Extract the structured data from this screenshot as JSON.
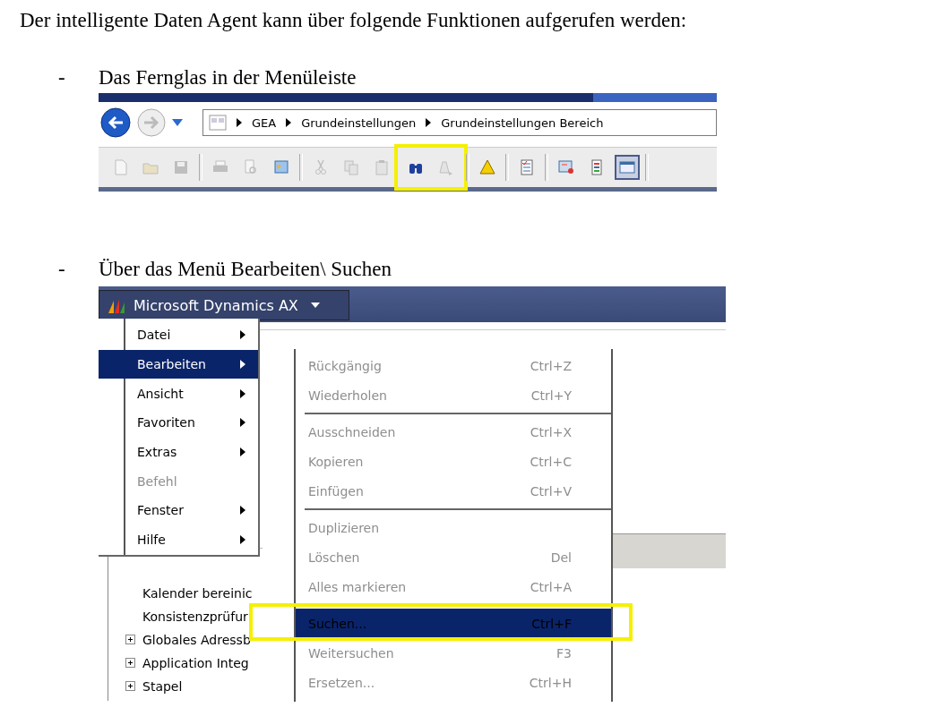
{
  "intro": "Der intelligente Daten Agent kann über folgende Funktionen aufgerufen werden:",
  "sections": [
    {
      "bullet": "-",
      "label": "Das Fernglas in der Menüleiste",
      "kind": "toolbar_shot"
    },
    {
      "bullet": "-",
      "label": "Über das Menü Bearbeiten\\ Suchen",
      "kind": "menu_shot"
    }
  ],
  "toolbar_shot": {
    "breadcrumb": [
      "GEA",
      "Grundeinstellungen",
      "Grundeinstellungen Bereich"
    ],
    "groups": [
      {
        "highlighted": false,
        "separator_after": true,
        "buttons": [
          {
            "disabled": true,
            "pressed": false
          },
          {
            "disabled": true,
            "pressed": false
          },
          {
            "disabled": true,
            "pressed": false
          }
        ]
      },
      {
        "highlighted": false,
        "separator_after": true,
        "buttons": [
          {
            "disabled": true,
            "pressed": false
          },
          {
            "disabled": true,
            "pressed": false
          },
          {
            "disabled": false,
            "pressed": false
          }
        ]
      },
      {
        "highlighted": false,
        "separator_after": false,
        "buttons": [
          {
            "disabled": true,
            "pressed": false
          },
          {
            "disabled": true,
            "pressed": false
          },
          {
            "disabled": true,
            "pressed": false
          }
        ]
      },
      {
        "highlighted": true,
        "separator_after": true,
        "buttons": [
          {
            "disabled": false,
            "pressed": false
          },
          {
            "disabled": true,
            "pressed": false
          }
        ]
      },
      {
        "highlighted": false,
        "separator_after": true,
        "buttons": [
          {
            "disabled": false,
            "pressed": false
          }
        ]
      },
      {
        "highlighted": false,
        "separator_after": true,
        "buttons": [
          {
            "disabled": false,
            "pressed": false
          }
        ]
      },
      {
        "highlighted": false,
        "separator_after": true,
        "buttons": [
          {
            "disabled": false,
            "pressed": false
          },
          {
            "disabled": false,
            "pressed": false
          },
          {
            "disabled": false,
            "pressed": true
          }
        ]
      }
    ]
  },
  "menu_shot": {
    "app_menu": "Microsoft Dynamics AX",
    "menu": [
      {
        "label": "Datei",
        "submenu": true,
        "disabled": false,
        "selected": false
      },
      {
        "label": "Bearbeiten",
        "submenu": true,
        "disabled": false,
        "selected": true
      },
      {
        "label": "Ansicht",
        "submenu": true,
        "disabled": false,
        "selected": false
      },
      {
        "label": "Favoriten",
        "submenu": true,
        "disabled": false,
        "selected": false
      },
      {
        "label": "Extras",
        "submenu": true,
        "disabled": false,
        "selected": false
      },
      {
        "label": "Befehl",
        "submenu": false,
        "disabled": true,
        "selected": false
      },
      {
        "label": "Fenster",
        "submenu": true,
        "disabled": false,
        "selected": false
      },
      {
        "label": "Hilfe",
        "submenu": true,
        "disabled": false,
        "selected": false
      }
    ],
    "submenu": [
      {
        "label": "Rückgängig",
        "shortcut": "Ctrl+Z",
        "disabled": true,
        "selected": false,
        "separator_before": false
      },
      {
        "label": "Wiederholen",
        "shortcut": "Ctrl+Y",
        "disabled": true,
        "selected": false,
        "separator_before": false
      },
      {
        "label": "Ausschneiden",
        "shortcut": "Ctrl+X",
        "disabled": true,
        "selected": false,
        "separator_before": true
      },
      {
        "label": "Kopieren",
        "shortcut": "Ctrl+C",
        "disabled": true,
        "selected": false,
        "separator_before": false
      },
      {
        "label": "Einfügen",
        "shortcut": "Ctrl+V",
        "disabled": true,
        "selected": false,
        "separator_before": false
      },
      {
        "label": "Duplizieren",
        "disabled": true,
        "selected": false,
        "separator_before": true
      },
      {
        "label": "Löschen",
        "shortcut": "Del",
        "disabled": true,
        "selected": false,
        "separator_before": false
      },
      {
        "label": "Alles markieren",
        "shortcut": "Ctrl+A",
        "disabled": true,
        "selected": false,
        "separator_before": false
      },
      {
        "label": "Suchen...",
        "shortcut": "Ctrl+F",
        "disabled": false,
        "selected": true,
        "separator_before": true
      },
      {
        "label": "Weitersuchen",
        "shortcut": "F3",
        "disabled": true,
        "selected": false,
        "separator_before": false
      },
      {
        "label": "Ersetzen...",
        "shortcut": "Ctrl+H",
        "disabled": true,
        "selected": false,
        "separator_before": false
      }
    ],
    "tree": [
      {
        "label": "Kalender bereinic",
        "expandable": false
      },
      {
        "label": "Konsistenzprüfur",
        "expandable": false
      },
      {
        "label": "Globales Adressb",
        "expandable": true
      },
      {
        "label": "Application Integ",
        "expandable": true
      },
      {
        "label": "Stapel",
        "expandable": true
      }
    ]
  }
}
